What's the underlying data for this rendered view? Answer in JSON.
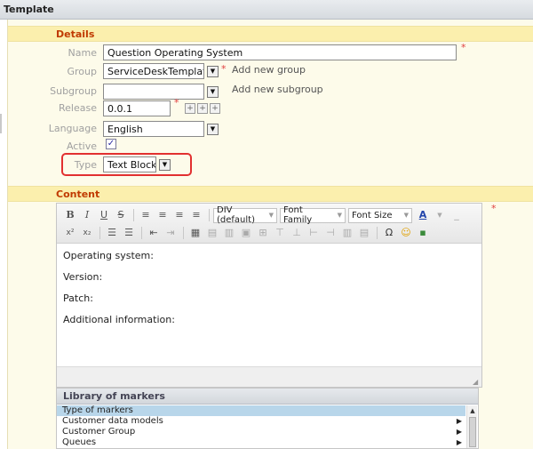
{
  "panel": {
    "title": "Template"
  },
  "details": {
    "section_title": "Details",
    "name": {
      "label": "Name",
      "value": "Question Operating System"
    },
    "group": {
      "label": "Group",
      "value": "ServiceDeskTemplates",
      "add_link": "Add new group"
    },
    "subgroup": {
      "label": "Subgroup",
      "value": "",
      "add_link": "Add new subgroup"
    },
    "release": {
      "label": "Release",
      "value": "0.0.1"
    },
    "language": {
      "label": "Language",
      "value": "English"
    },
    "active": {
      "label": "Active",
      "checked": true
    },
    "type": {
      "label": "Type",
      "value": "Text Block"
    },
    "required_mark": "*"
  },
  "content": {
    "section_title": "Content",
    "toolbar": {
      "format_select": "DIV (default)",
      "font_family_select": "Font Family",
      "font_size_select": "Font Size"
    },
    "body_lines": [
      "Operating system:",
      "Version:",
      "Patch:",
      "Additional information:"
    ]
  },
  "library": {
    "title": "Library of markers",
    "rows": [
      "Type of markers",
      "Customer data models",
      "Customer Group",
      "Queues"
    ]
  },
  "colors": {
    "section_title_text": "#c03a00",
    "section_title_bg": "#fbefad",
    "form_bg": "#fdfbea",
    "highlight_border": "#e23030",
    "selected_row": "#b8d6ea"
  }
}
